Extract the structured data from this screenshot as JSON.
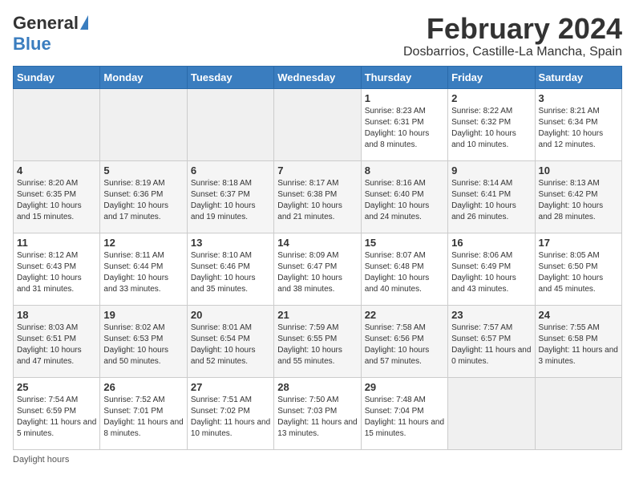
{
  "logo": {
    "general": "General",
    "blue": "Blue"
  },
  "title": "February 2024",
  "subtitle": "Dosbarrios, Castille-La Mancha, Spain",
  "days_of_week": [
    "Sunday",
    "Monday",
    "Tuesday",
    "Wednesday",
    "Thursday",
    "Friday",
    "Saturday"
  ],
  "weeks": [
    [
      {
        "num": "",
        "info": ""
      },
      {
        "num": "",
        "info": ""
      },
      {
        "num": "",
        "info": ""
      },
      {
        "num": "",
        "info": ""
      },
      {
        "num": "1",
        "info": "Sunrise: 8:23 AM\nSunset: 6:31 PM\nDaylight: 10 hours and 8 minutes."
      },
      {
        "num": "2",
        "info": "Sunrise: 8:22 AM\nSunset: 6:32 PM\nDaylight: 10 hours and 10 minutes."
      },
      {
        "num": "3",
        "info": "Sunrise: 8:21 AM\nSunset: 6:34 PM\nDaylight: 10 hours and 12 minutes."
      }
    ],
    [
      {
        "num": "4",
        "info": "Sunrise: 8:20 AM\nSunset: 6:35 PM\nDaylight: 10 hours and 15 minutes."
      },
      {
        "num": "5",
        "info": "Sunrise: 8:19 AM\nSunset: 6:36 PM\nDaylight: 10 hours and 17 minutes."
      },
      {
        "num": "6",
        "info": "Sunrise: 8:18 AM\nSunset: 6:37 PM\nDaylight: 10 hours and 19 minutes."
      },
      {
        "num": "7",
        "info": "Sunrise: 8:17 AM\nSunset: 6:38 PM\nDaylight: 10 hours and 21 minutes."
      },
      {
        "num": "8",
        "info": "Sunrise: 8:16 AM\nSunset: 6:40 PM\nDaylight: 10 hours and 24 minutes."
      },
      {
        "num": "9",
        "info": "Sunrise: 8:14 AM\nSunset: 6:41 PM\nDaylight: 10 hours and 26 minutes."
      },
      {
        "num": "10",
        "info": "Sunrise: 8:13 AM\nSunset: 6:42 PM\nDaylight: 10 hours and 28 minutes."
      }
    ],
    [
      {
        "num": "11",
        "info": "Sunrise: 8:12 AM\nSunset: 6:43 PM\nDaylight: 10 hours and 31 minutes."
      },
      {
        "num": "12",
        "info": "Sunrise: 8:11 AM\nSunset: 6:44 PM\nDaylight: 10 hours and 33 minutes."
      },
      {
        "num": "13",
        "info": "Sunrise: 8:10 AM\nSunset: 6:46 PM\nDaylight: 10 hours and 35 minutes."
      },
      {
        "num": "14",
        "info": "Sunrise: 8:09 AM\nSunset: 6:47 PM\nDaylight: 10 hours and 38 minutes."
      },
      {
        "num": "15",
        "info": "Sunrise: 8:07 AM\nSunset: 6:48 PM\nDaylight: 10 hours and 40 minutes."
      },
      {
        "num": "16",
        "info": "Sunrise: 8:06 AM\nSunset: 6:49 PM\nDaylight: 10 hours and 43 minutes."
      },
      {
        "num": "17",
        "info": "Sunrise: 8:05 AM\nSunset: 6:50 PM\nDaylight: 10 hours and 45 minutes."
      }
    ],
    [
      {
        "num": "18",
        "info": "Sunrise: 8:03 AM\nSunset: 6:51 PM\nDaylight: 10 hours and 47 minutes."
      },
      {
        "num": "19",
        "info": "Sunrise: 8:02 AM\nSunset: 6:53 PM\nDaylight: 10 hours and 50 minutes."
      },
      {
        "num": "20",
        "info": "Sunrise: 8:01 AM\nSunset: 6:54 PM\nDaylight: 10 hours and 52 minutes."
      },
      {
        "num": "21",
        "info": "Sunrise: 7:59 AM\nSunset: 6:55 PM\nDaylight: 10 hours and 55 minutes."
      },
      {
        "num": "22",
        "info": "Sunrise: 7:58 AM\nSunset: 6:56 PM\nDaylight: 10 hours and 57 minutes."
      },
      {
        "num": "23",
        "info": "Sunrise: 7:57 AM\nSunset: 6:57 PM\nDaylight: 11 hours and 0 minutes."
      },
      {
        "num": "24",
        "info": "Sunrise: 7:55 AM\nSunset: 6:58 PM\nDaylight: 11 hours and 3 minutes."
      }
    ],
    [
      {
        "num": "25",
        "info": "Sunrise: 7:54 AM\nSunset: 6:59 PM\nDaylight: 11 hours and 5 minutes."
      },
      {
        "num": "26",
        "info": "Sunrise: 7:52 AM\nSunset: 7:01 PM\nDaylight: 11 hours and 8 minutes."
      },
      {
        "num": "27",
        "info": "Sunrise: 7:51 AM\nSunset: 7:02 PM\nDaylight: 11 hours and 10 minutes."
      },
      {
        "num": "28",
        "info": "Sunrise: 7:50 AM\nSunset: 7:03 PM\nDaylight: 11 hours and 13 minutes."
      },
      {
        "num": "29",
        "info": "Sunrise: 7:48 AM\nSunset: 7:04 PM\nDaylight: 11 hours and 15 minutes."
      },
      {
        "num": "",
        "info": ""
      },
      {
        "num": "",
        "info": ""
      }
    ]
  ],
  "footer": "Daylight hours"
}
